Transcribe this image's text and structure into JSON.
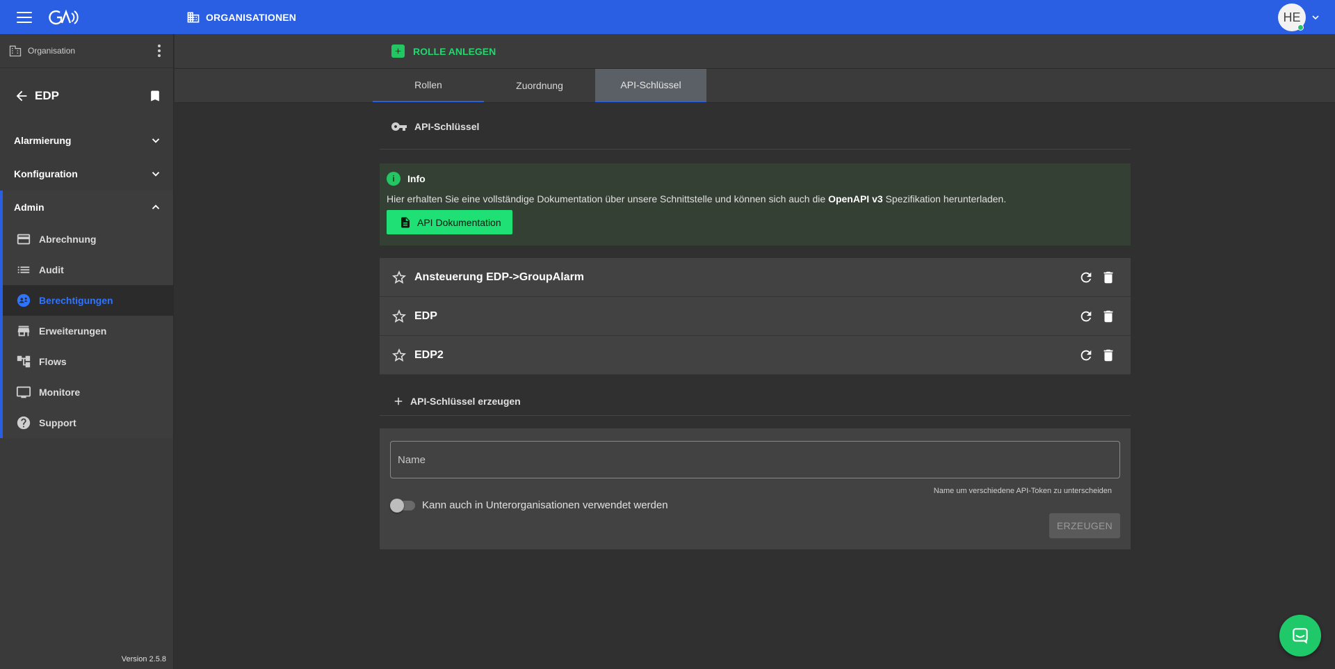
{
  "topbar": {
    "title": "ORGANISATIONEN",
    "avatar_initials": "HE"
  },
  "sidebar": {
    "org_label": "Organisation",
    "back_label": "EDP",
    "sections": [
      {
        "label": "Alarmierung"
      },
      {
        "label": "Konfiguration"
      },
      {
        "label": "Admin"
      }
    ],
    "admin_items": [
      {
        "label": "Abrechnung",
        "icon": "card-icon"
      },
      {
        "label": "Audit",
        "icon": "list-icon"
      },
      {
        "label": "Berechtigungen",
        "icon": "permissions-icon",
        "active": true
      },
      {
        "label": "Erweiterungen",
        "icon": "store-icon"
      },
      {
        "label": "Flows",
        "icon": "flows-icon"
      },
      {
        "label": "Monitore",
        "icon": "monitor-icon"
      },
      {
        "label": "Support",
        "icon": "help-icon"
      }
    ],
    "version": "Version 2.5.8"
  },
  "actions": {
    "add_role": "ROLLE ANLEGEN"
  },
  "tabs": [
    {
      "label": "Rollen"
    },
    {
      "label": "Zuordnung"
    },
    {
      "label": "API-Schlüssel",
      "active": true
    }
  ],
  "api": {
    "section_title": "API-Schlüssel",
    "info_title": "Info",
    "info_text_before": "Hier erhalten Sie eine vollständige Dokumentation über unsere Schnittstelle und können sich auch die ",
    "info_text_bold": "OpenAPI v3",
    "info_text_after": " Spezifikation herunterladen.",
    "doc_button": "API Dokumentation",
    "keys": [
      {
        "name": "Ansteuerung EDP->GroupAlarm"
      },
      {
        "name": "EDP"
      },
      {
        "name": "EDP2"
      }
    ],
    "create_header": "API-Schlüssel erzeugen",
    "name_placeholder": "Name",
    "name_value": "",
    "name_hint": "Name um verschiedene API-Token zu unterscheiden",
    "toggle_label": "Kann auch in Unterorganisationen verwendet werden",
    "toggle_on": false,
    "create_button": "ERZEUGEN"
  },
  "colors": {
    "primary": "#2a5fe3",
    "accent_green": "#1fe074",
    "active_nav": "#2f74ff"
  }
}
